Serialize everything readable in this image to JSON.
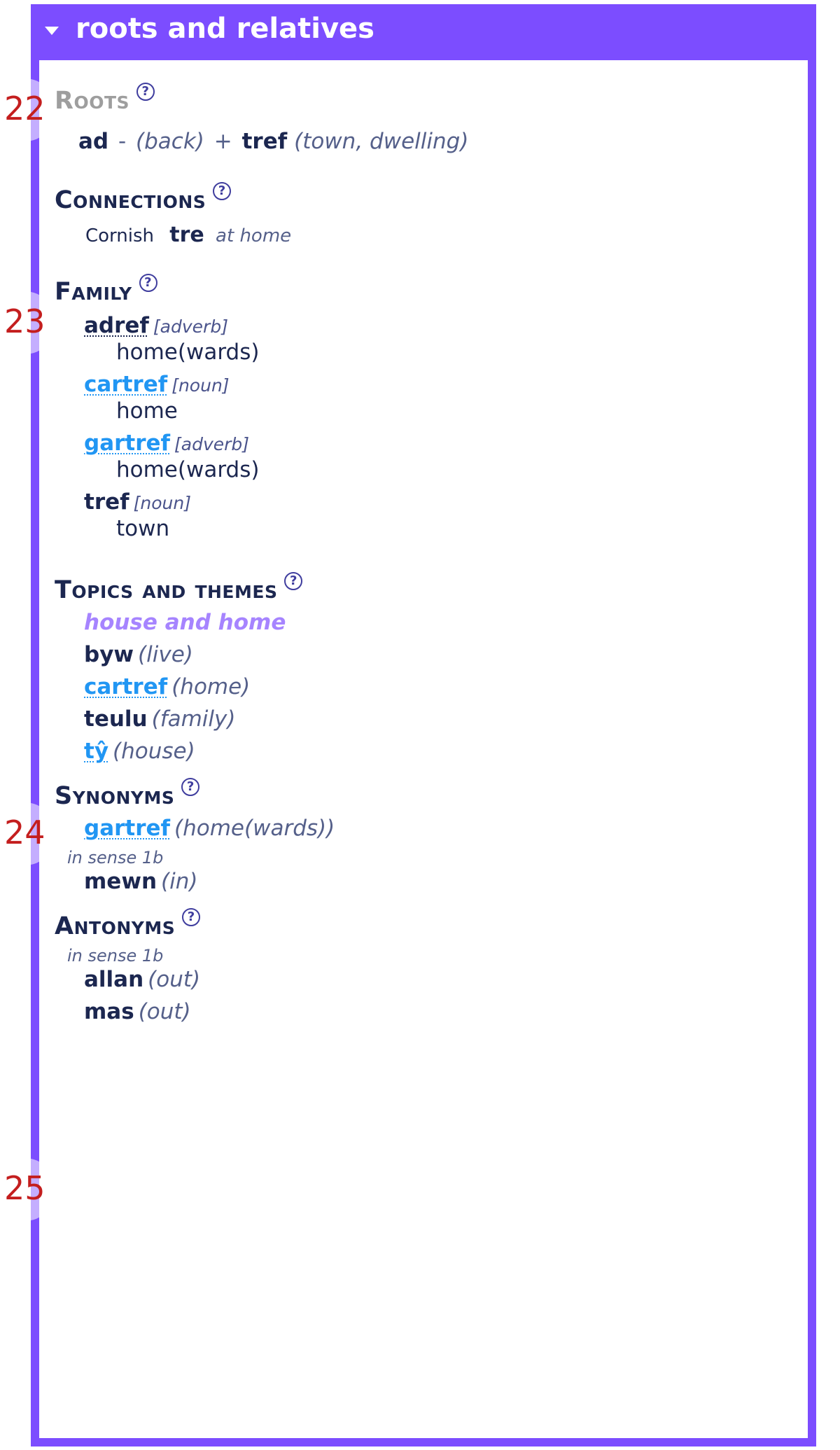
{
  "header": {
    "title": "roots and relatives"
  },
  "badges": {
    "b22": "22",
    "b23": "23",
    "b24": "24",
    "b25": "25"
  },
  "help_glyph": "?",
  "sections": {
    "roots": {
      "title": "Roots",
      "parts": [
        {
          "word": "ad",
          "gloss": "back",
          "dash": "-",
          "open": "(",
          "close": ")"
        },
        {
          "sep": "+"
        },
        {
          "word": "tref",
          "gloss": "town, dwelling",
          "open": "(",
          "close": ")"
        }
      ]
    },
    "connections": {
      "title": "Connections",
      "rows": [
        {
          "lang": "Cornish",
          "word": "tre",
          "gloss": "at home"
        }
      ]
    },
    "family": {
      "title": "Family",
      "items": [
        {
          "word": "adref",
          "style": "u-navy",
          "pos": "[adverb]",
          "def": "home(wards)"
        },
        {
          "word": "cartref",
          "style": "u-blue",
          "pos": "[noun]",
          "def": "home"
        },
        {
          "word": "gartref",
          "style": "u-blue",
          "pos": "[adverb]",
          "def": "home(wards)"
        },
        {
          "word": "tref",
          "style": "navy",
          "pos": "[noun]",
          "def": "town"
        }
      ]
    },
    "topics": {
      "title": "Topics and themes",
      "topic": "house and home",
      "items": [
        {
          "word": "byw",
          "style": "navy",
          "gloss": "(live)"
        },
        {
          "word": "cartref",
          "style": "u-blue",
          "gloss": "(home)"
        },
        {
          "word": "teulu",
          "style": "navy",
          "gloss": "(family)"
        },
        {
          "word": "tŷ",
          "style": "u-blue",
          "gloss": "(house)"
        }
      ]
    },
    "synonyms": {
      "title": "Synonyms",
      "items_a": [
        {
          "word": "gartref",
          "style": "u-blue",
          "gloss": "(home(wards))"
        }
      ],
      "sense": "in sense 1b",
      "items_b": [
        {
          "word": "mewn",
          "style": "navy",
          "gloss": "(in)"
        }
      ]
    },
    "antonyms": {
      "title": "Antonyms",
      "sense": "in sense 1b",
      "items": [
        {
          "word": "allan",
          "style": "navy",
          "gloss": "(out)"
        },
        {
          "word": "mas",
          "style": "navy",
          "gloss": "(out)"
        }
      ]
    }
  }
}
